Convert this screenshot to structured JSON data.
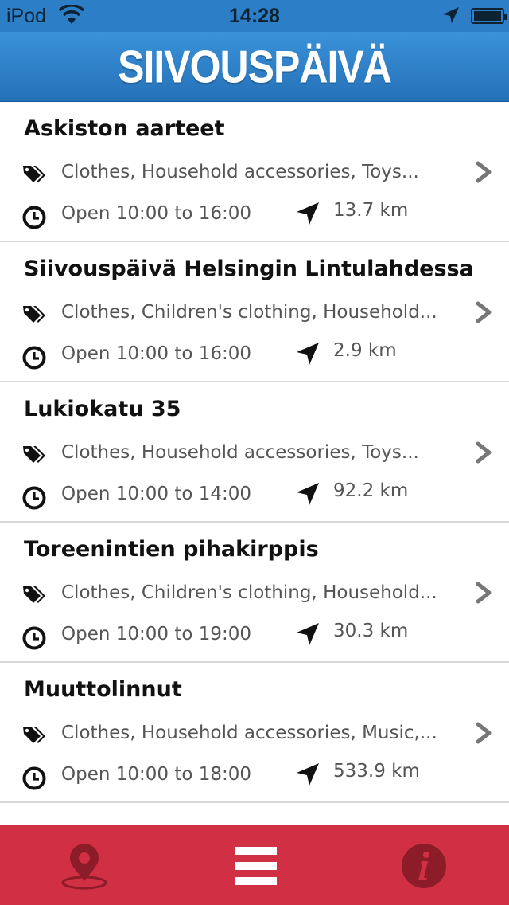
{
  "status_bar": {
    "carrier": "iPod",
    "time": "14:28"
  },
  "nav_bar": {
    "title": "SIIVOUSPÄIVÄ"
  },
  "sales": [
    {
      "title": "Askiston aarteet",
      "categories": "Clothes, Household accessories, Toys...",
      "hours": "Open 10:00 to 16:00",
      "distance": "13.7 km"
    },
    {
      "title": "Siivouspäivä Helsingin Lintulahdessa",
      "categories": "Clothes, Children's clothing, Household...",
      "hours": "Open 10:00 to 16:00",
      "distance": "2.9 km"
    },
    {
      "title": "Lukiokatu 35",
      "categories": "Clothes, Household accessories, Toys...",
      "hours": "Open 10:00 to 14:00",
      "distance": "92.2 km"
    },
    {
      "title": "Toreenintien pihakirppis",
      "categories": "Clothes, Children's clothing, Household...",
      "hours": "Open 10:00 to 19:00",
      "distance": "30.3 km"
    },
    {
      "title": "Muuttolinnut",
      "categories": "Clothes, Household accessories, Music,...",
      "hours": "Open 10:00 to 18:00",
      "distance": "533.9 km"
    }
  ],
  "tabs": [
    {
      "icon": "map-pin-icon",
      "active": false
    },
    {
      "icon": "list-menu-icon",
      "active": true
    },
    {
      "icon": "info-icon",
      "active": false
    }
  ],
  "colors": {
    "nav_bar": "#2c7fc6",
    "tab_bar": "#d12f43",
    "tab_inactive_icon": "#8c1c27",
    "tab_active_icon": "#ffffff"
  }
}
